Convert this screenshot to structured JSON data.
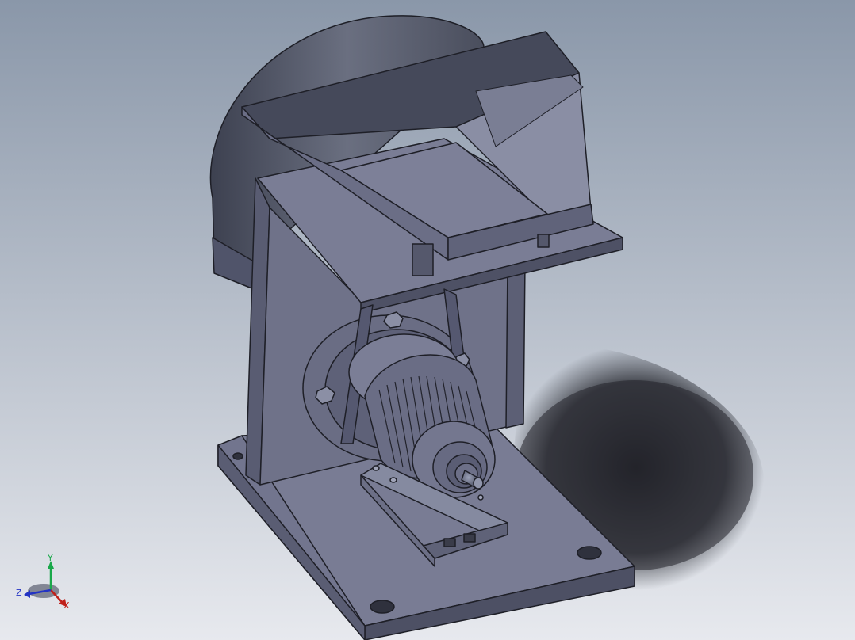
{
  "viewport": {
    "background_top": "#8a97a9",
    "background_bottom": "#e7e9ee"
  },
  "triad": {
    "x_label": "X",
    "y_label": "Y",
    "z_label": "Z",
    "x_color": "#c0201a",
    "y_color": "#19a84a",
    "z_color": "#2233c4"
  },
  "model": {
    "body_color": "#6b6e86",
    "edge_color": "#1e1f27"
  }
}
